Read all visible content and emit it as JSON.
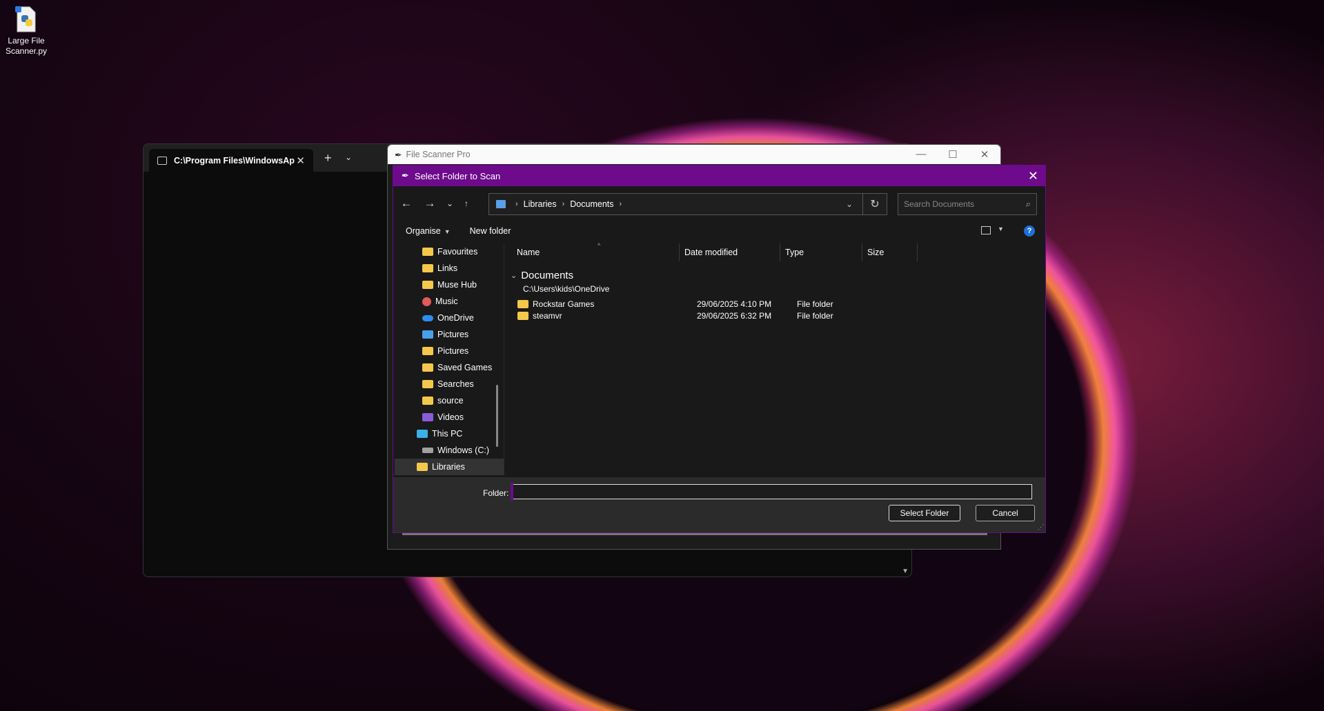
{
  "desktop": {
    "icon_label": "Large File Scanner.py"
  },
  "terminal": {
    "tab_title": "C:\\Program Files\\WindowsAp",
    "tab_close": "✕",
    "new_tab": "+",
    "tab_menu": "⌄"
  },
  "app_window": {
    "title": "File Scanner Pro",
    "minimize": "—",
    "maximize": "☐",
    "close": "✕"
  },
  "dialog": {
    "title": "Select Folder to Scan",
    "close": "✕",
    "nav": {
      "back": "←",
      "forward": "→",
      "recent": "⌄",
      "up": "↑"
    },
    "address": {
      "crumbs": [
        "Libraries",
        "Documents"
      ],
      "separator": "›",
      "dropdown": "⌄",
      "refresh": "↻"
    },
    "search": {
      "placeholder": "Search Documents",
      "icon": "⌕"
    },
    "commands": {
      "organise": "Organise",
      "new_folder": "New folder",
      "help": "?"
    },
    "nav_pane": [
      {
        "label": "Favourites",
        "icon": "folder-icon"
      },
      {
        "label": "Links",
        "icon": "folder-icon"
      },
      {
        "label": "Muse Hub",
        "icon": "folder-icon"
      },
      {
        "label": "Music",
        "icon": "music-icon"
      },
      {
        "label": "OneDrive",
        "icon": "cloud-icon"
      },
      {
        "label": "Pictures",
        "icon": "pictures-icon"
      },
      {
        "label": "Pictures",
        "icon": "folder-icon"
      },
      {
        "label": "Saved Games",
        "icon": "folder-icon"
      },
      {
        "label": "Searches",
        "icon": "folder-icon"
      },
      {
        "label": "source",
        "icon": "folder-icon"
      },
      {
        "label": "Videos",
        "icon": "videos-icon"
      },
      {
        "label": "This PC",
        "icon": "computer-icon"
      },
      {
        "label": "Windows (C:)",
        "icon": "drive-icon"
      },
      {
        "label": "Libraries",
        "icon": "folder-icon"
      }
    ],
    "columns": {
      "name": "Name",
      "date": "Date modified",
      "type": "Type",
      "size": "Size"
    },
    "group": {
      "title": "Documents",
      "path": "C:\\Users\\kids\\OneDrive"
    },
    "files": [
      {
        "name": "Rockstar Games",
        "date": "29/06/2025 4:10 PM",
        "type": "File folder"
      },
      {
        "name": "steamvr",
        "date": "29/06/2025 6:32 PM",
        "type": "File folder"
      }
    ],
    "folder_label": "Folder:",
    "folder_value": "",
    "select_button": "Select Folder",
    "cancel_button": "Cancel"
  },
  "colors": {
    "dialog_accent": "#6e0a8c",
    "folder": "#f4c84a",
    "help": "#1e6fd9"
  }
}
